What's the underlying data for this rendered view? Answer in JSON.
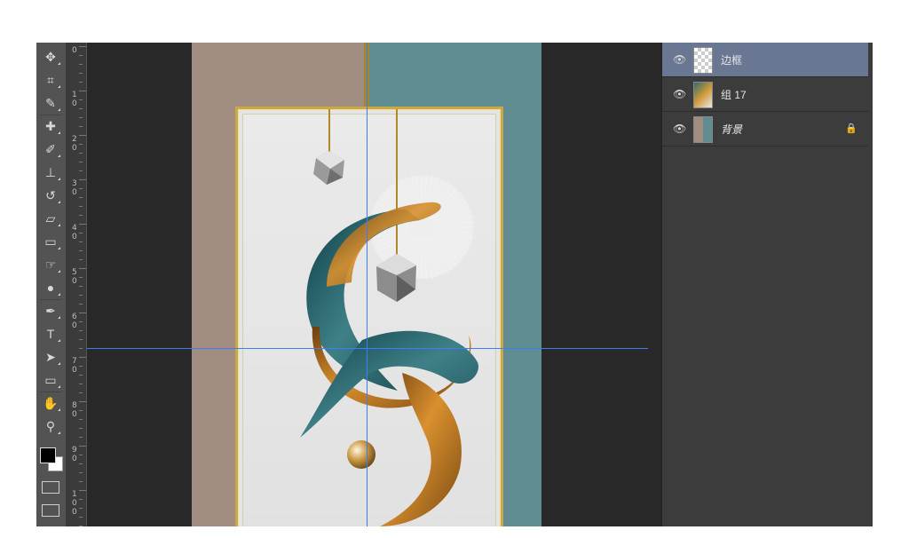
{
  "ruler": {
    "labels": [
      "0",
      "1\n0",
      "2\n0",
      "3\n0",
      "4\n0",
      "5\n0",
      "6\n0",
      "7\n0",
      "8\n0",
      "9\n0",
      "1\n0\n0"
    ]
  },
  "toolbar": {
    "tools": [
      {
        "name": "move-tool",
        "icon": "✥"
      },
      {
        "name": "crop-tool",
        "icon": "⌗"
      },
      {
        "name": "eyedropper-tool",
        "icon": "✎"
      },
      {
        "name": "healing-brush-tool",
        "icon": "✚"
      },
      {
        "name": "brush-tool",
        "icon": "✐"
      },
      {
        "name": "clone-stamp-tool",
        "icon": "⊥"
      },
      {
        "name": "history-brush-tool",
        "icon": "↺"
      },
      {
        "name": "eraser-tool",
        "icon": "▱"
      },
      {
        "name": "gradient-tool",
        "icon": "▭"
      },
      {
        "name": "smudge-tool",
        "icon": "☞"
      },
      {
        "name": "dodge-tool",
        "icon": "●"
      },
      {
        "name": "pen-tool",
        "icon": "✒"
      },
      {
        "name": "text-tool",
        "icon": "T"
      },
      {
        "name": "path-selection-tool",
        "icon": "➤"
      },
      {
        "name": "rectangle-tool",
        "icon": "▭"
      },
      {
        "name": "hand-tool",
        "icon": "✋"
      },
      {
        "name": "zoom-tool",
        "icon": "⚲"
      }
    ]
  },
  "layers": [
    {
      "name": "边框",
      "selected": true,
      "thumb": "transparent",
      "locked": false
    },
    {
      "name": "组 17",
      "selected": false,
      "thumb": "art",
      "locked": false
    },
    {
      "name": "背景",
      "selected": false,
      "thumb": "background",
      "locked": true
    }
  ],
  "colors": {
    "foreground": "#000000",
    "background": "#ffffff",
    "selected_layer": "#6a7792",
    "guide": "#3d7bff"
  }
}
